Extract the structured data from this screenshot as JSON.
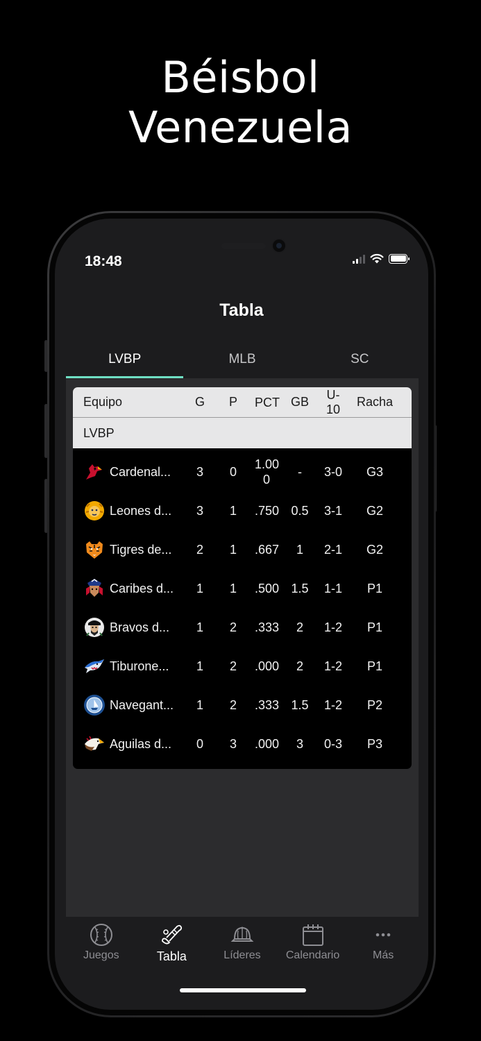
{
  "promo": {
    "line1": "Béisbol",
    "line2": "Venezuela"
  },
  "status_bar": {
    "time": "18:48",
    "signal_icon": "cellular-signal-icon",
    "wifi_icon": "wifi-icon",
    "battery_icon": "battery-icon"
  },
  "nav": {
    "title": "Tabla"
  },
  "tabs": [
    {
      "label": "LVBP",
      "active": true
    },
    {
      "label": "MLB",
      "active": false
    },
    {
      "label": "SC",
      "active": false
    }
  ],
  "colors": {
    "accent": "#6fe0c4",
    "header_bg": "#e7e7e8",
    "screen_bg": "#1c1c1e",
    "content_bg": "#2c2c2e"
  },
  "standings": {
    "columns": {
      "team": "Equipo",
      "g": "G",
      "p": "P",
      "pct": "PCT",
      "gb": "GB",
      "u10": "U-10",
      "streak": "Racha"
    },
    "section": "LVBP",
    "rows": [
      {
        "team": "Cardenal...",
        "logo": "cardenales-logo-icon",
        "g": "3",
        "p": "0",
        "pct": "1.00\n0",
        "gb": "-",
        "u10": "3-0",
        "streak": "G3"
      },
      {
        "team": "Leones d...",
        "logo": "leones-logo-icon",
        "g": "3",
        "p": "1",
        "pct": ".750",
        "gb": "0.5",
        "u10": "3-1",
        "streak": "G2"
      },
      {
        "team": "Tigres de...",
        "logo": "tigres-logo-icon",
        "g": "2",
        "p": "1",
        "pct": ".667",
        "gb": "1",
        "u10": "2-1",
        "streak": "G2"
      },
      {
        "team": "Caribes d...",
        "logo": "caribes-logo-icon",
        "g": "1",
        "p": "1",
        "pct": ".500",
        "gb": "1.5",
        "u10": "1-1",
        "streak": "P1"
      },
      {
        "team": "Bravos d...",
        "logo": "bravos-logo-icon",
        "g": "1",
        "p": "2",
        "pct": ".333",
        "gb": "2",
        "u10": "1-2",
        "streak": "P1"
      },
      {
        "team": "Tiburone...",
        "logo": "tiburones-logo-icon",
        "g": "1",
        "p": "2",
        "pct": ".000",
        "gb": "2",
        "u10": "1-2",
        "streak": "P1"
      },
      {
        "team": "Navegant...",
        "logo": "navegantes-logo-icon",
        "g": "1",
        "p": "2",
        "pct": ".333",
        "gb": "1.5",
        "u10": "1-2",
        "streak": "P2"
      },
      {
        "team": "Aguilas d...",
        "logo": "aguilas-logo-icon",
        "g": "0",
        "p": "3",
        "pct": ".000",
        "gb": "3",
        "u10": "0-3",
        "streak": "P3"
      }
    ]
  },
  "tabbar": [
    {
      "label": "Juegos",
      "icon": "baseball-icon",
      "active": false
    },
    {
      "label": "Tabla",
      "icon": "standings-bat-icon",
      "active": true
    },
    {
      "label": "Líderes",
      "icon": "cap-icon",
      "active": false
    },
    {
      "label": "Calendario",
      "icon": "calendar-icon",
      "active": false
    },
    {
      "label": "Más",
      "icon": "more-dots-icon",
      "active": false
    }
  ]
}
